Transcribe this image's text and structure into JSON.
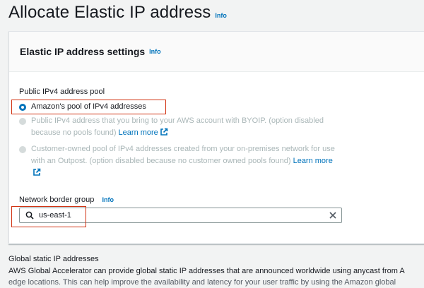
{
  "page": {
    "title": "Allocate Elastic IP address",
    "info_label": "Info"
  },
  "settings": {
    "title": "Elastic IP address settings",
    "info_label": "Info",
    "pool_label": "Public IPv4 address pool",
    "options": [
      {
        "label": "Amazon's pool of IPv4 addresses",
        "selected": true,
        "disabled": false
      },
      {
        "label": "Public IPv4 address that you bring to your AWS account with BYOIP. (option disabled because no pools found)",
        "link": "Learn more",
        "selected": false,
        "disabled": true
      },
      {
        "label": "Customer-owned pool of IPv4 addresses created from your on-premises network for use with an Outpost. (option disabled because no customer owned pools found)",
        "link": "Learn more",
        "selected": false,
        "disabled": true
      }
    ],
    "nbg_label": "Network border group",
    "nbg_info": "Info",
    "nbg_value": "us-east-1"
  },
  "global": {
    "title": "Global static IP addresses",
    "desc_line1": "AWS Global Accelerator can provide global static IP addresses that are announced worldwide using anycast from A",
    "desc_line2": "edge locations. This can help improve the availability and latency for your user traffic by using the Amazon global"
  },
  "colors": {
    "accent": "#0073bb",
    "highlight": "#d13212",
    "disabled_text": "#aab7b8",
    "background": "#f2f3f3"
  },
  "icons": {
    "search": "search-icon",
    "clear": "close-icon",
    "external": "external-link-icon"
  }
}
